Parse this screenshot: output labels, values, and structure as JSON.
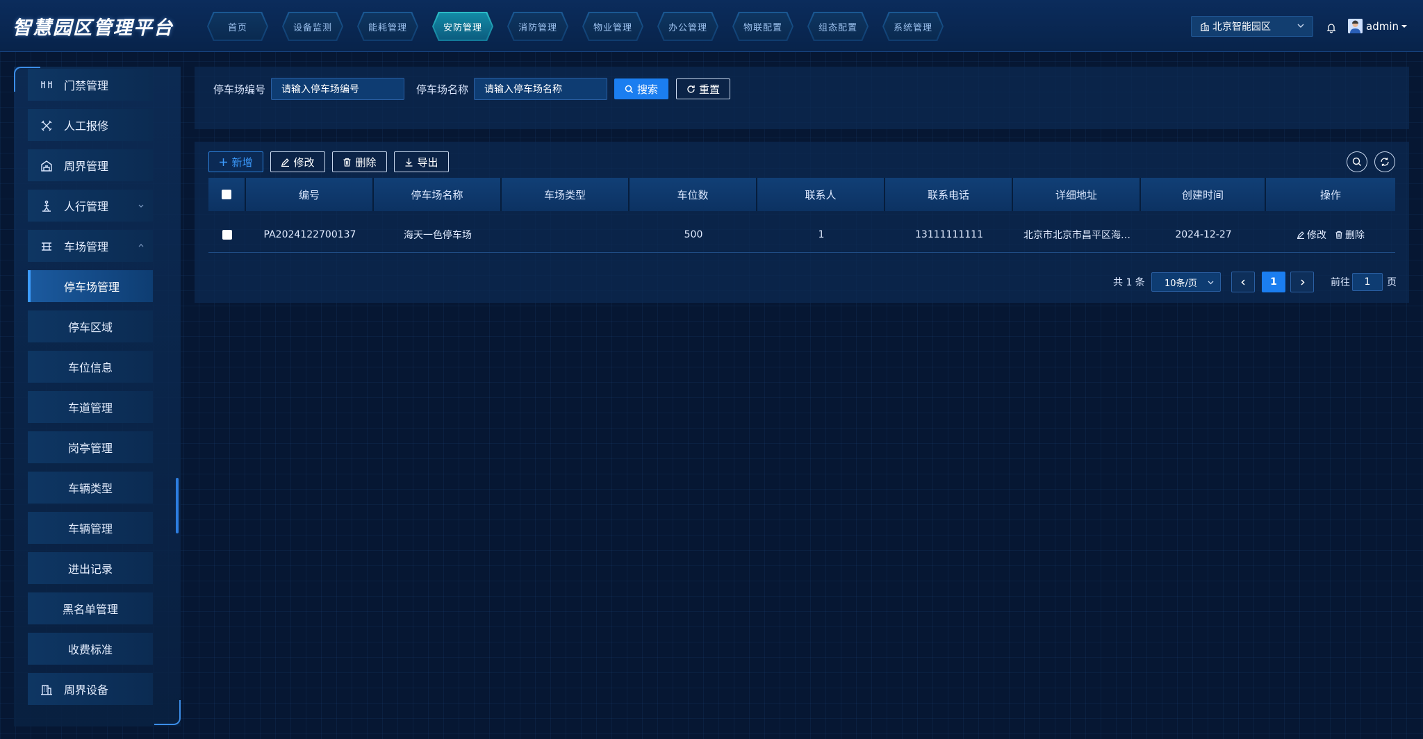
{
  "app": {
    "title": "智慧园区管理平台"
  },
  "nav": {
    "items": [
      {
        "label": "首页"
      },
      {
        "label": "设备监测"
      },
      {
        "label": "能耗管理"
      },
      {
        "label": "安防管理",
        "active": true
      },
      {
        "label": "消防管理"
      },
      {
        "label": "物业管理"
      },
      {
        "label": "办公管理"
      },
      {
        "label": "物联配置"
      },
      {
        "label": "组态配置"
      },
      {
        "label": "系统管理"
      }
    ]
  },
  "header": {
    "park_selected": "北京智能园区",
    "username": "admin"
  },
  "sidebar": {
    "menus": [
      {
        "label": "门禁管理",
        "icon": "gate-icon"
      },
      {
        "label": "人工报修",
        "icon": "tools-icon"
      },
      {
        "label": "周界管理",
        "icon": "perimeter-icon"
      },
      {
        "label": "人行管理",
        "icon": "pedestrian-icon",
        "expandable": true
      },
      {
        "label": "车场管理",
        "icon": "parking-icon",
        "expanded": true
      }
    ],
    "sub_items": [
      {
        "label": "停车场管理",
        "active": true
      },
      {
        "label": "停车区域"
      },
      {
        "label": "车位信息"
      },
      {
        "label": "车道管理"
      },
      {
        "label": "岗亭管理"
      },
      {
        "label": "车辆类型"
      },
      {
        "label": "车辆管理"
      },
      {
        "label": "进出记录"
      },
      {
        "label": "黑名单管理"
      },
      {
        "label": "收费标准"
      }
    ],
    "last_menu": {
      "label": "周界设备",
      "icon": "device-icon"
    }
  },
  "search": {
    "code_label": "停车场编号",
    "code_placeholder": "请输入停车场编号",
    "name_label": "停车场名称",
    "name_placeholder": "请输入停车场名称",
    "search_btn": "搜索",
    "reset_btn": "重置"
  },
  "toolbar": {
    "add": "新增",
    "edit": "修改",
    "delete": "删除",
    "export": "导出"
  },
  "table": {
    "columns": [
      "编号",
      "停车场名称",
      "车场类型",
      "车位数",
      "联系人",
      "联系电话",
      "详细地址",
      "创建时间",
      "操作"
    ],
    "rows": [
      {
        "code": "PA2024122700137",
        "name": "海天一色停车场",
        "type": "",
        "spaces": "500",
        "contact": "1",
        "phone": "13111111111",
        "address": "北京市北京市昌平区海…",
        "created": "2024-12-27",
        "op_edit": "修改",
        "op_delete": "删除"
      }
    ]
  },
  "pagination": {
    "total": "共 1 条",
    "page_size": "10条/页",
    "current_page": "1",
    "goto_label": "前往",
    "goto_value": "1",
    "goto_suffix": "页"
  }
}
